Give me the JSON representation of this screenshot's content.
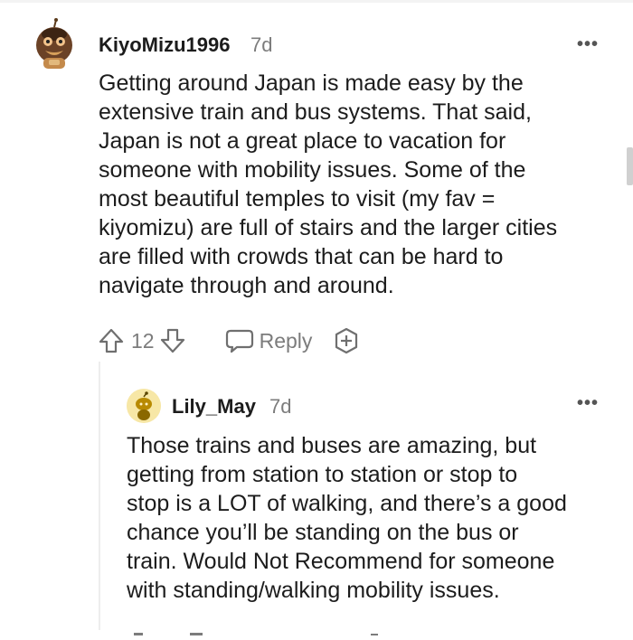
{
  "comment": {
    "username": "KiyoMizu1996",
    "timestamp": "7d",
    "more_label": "•••",
    "body_lines": [
      "Getting around Japan is made easy by the",
      "extensive train and bus systems. That said,",
      "Japan is not a great place to vacation for",
      "someone with mobility issues. Some of the",
      "most beautiful temples to visit (my fav =",
      "kiyomizu) are full of stairs and the larger cities",
      "are filled with crowds that can be hard to",
      "navigate through and around."
    ],
    "actions": {
      "vote_count": "12",
      "reply_label": "Reply"
    }
  },
  "reply": {
    "username": "Lily_May",
    "timestamp": "7d",
    "more_label": "•••",
    "body_lines": [
      "Those trains and buses are amazing, but",
      "getting from station to station or stop to",
      "stop is a LOT of walking, and there’s a good",
      "chance you’ll be standing on the bus or",
      "train. Would Not Recommend for someone",
      "with standing/walking mobility issues."
    ]
  },
  "icons": {
    "upvote": "arrow-up-icon",
    "downvote": "arrow-down-icon",
    "reply": "speech-bubble-icon",
    "award": "plus-hexagon-icon",
    "more": "more-dots-icon"
  },
  "colors": {
    "text": "#1c1c1c",
    "muted": "#7c7c7c",
    "divider": "#ededed"
  }
}
